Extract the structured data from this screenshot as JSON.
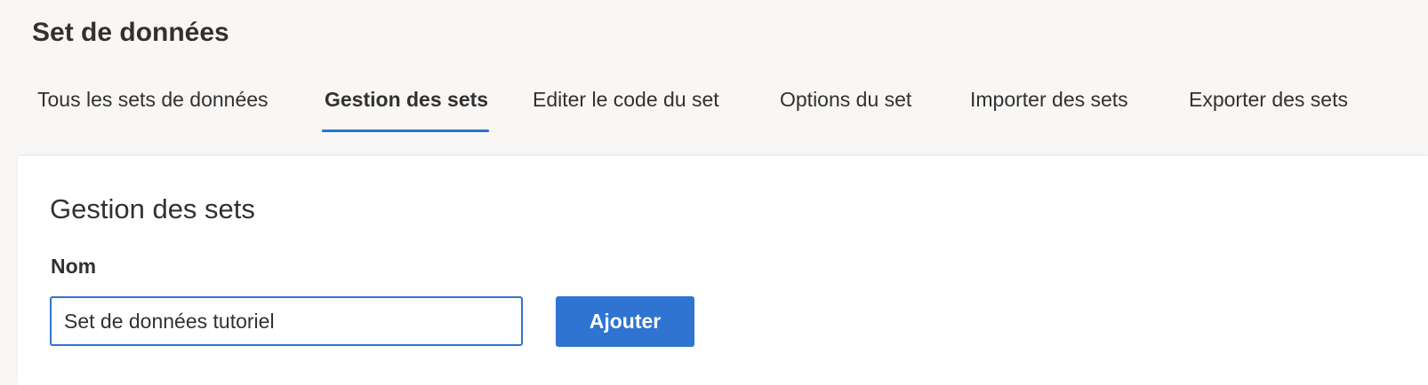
{
  "header": {
    "title": "Set de données"
  },
  "tabs": [
    {
      "label": "Tous les sets de données",
      "active": false
    },
    {
      "label": "Gestion des sets",
      "active": true
    },
    {
      "label": "Editer le code du set",
      "active": false
    },
    {
      "label": "Options du set",
      "active": false
    },
    {
      "label": "Importer des sets",
      "active": false
    },
    {
      "label": "Exporter des sets",
      "active": false
    }
  ],
  "main": {
    "section_title": "Gestion des sets",
    "name_field": {
      "label": "Nom",
      "value": "Set de données tutoriel",
      "placeholder": ""
    },
    "add_button_label": "Ajouter"
  },
  "colors": {
    "accent": "#2f74d0",
    "header_background": "#f8f7f6",
    "content_background": "#ffffff",
    "text": "#323130"
  }
}
